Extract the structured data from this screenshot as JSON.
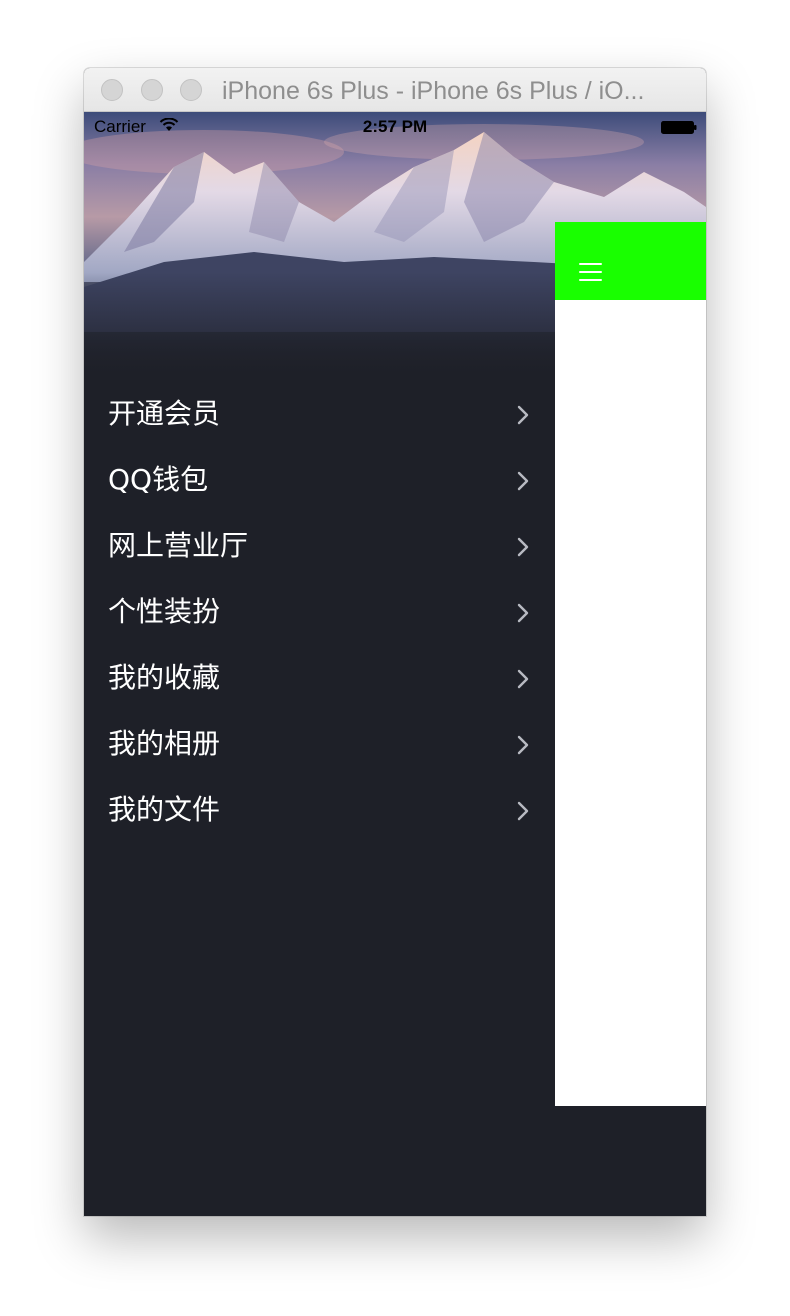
{
  "window": {
    "title": "iPhone 6s Plus - iPhone 6s Plus / iO..."
  },
  "status_bar": {
    "carrier": "Carrier",
    "time": "2:57 PM",
    "wifi_icon": "wifi-icon",
    "battery_icon": "battery-full-icon"
  },
  "menu": {
    "items": [
      {
        "label": "开通会员",
        "icon": "chevron-right-icon"
      },
      {
        "label": "QQ钱包",
        "icon": "chevron-right-icon"
      },
      {
        "label": "网上营业厅",
        "icon": "chevron-right-icon"
      },
      {
        "label": "个性装扮",
        "icon": "chevron-right-icon"
      },
      {
        "label": "我的收藏",
        "icon": "chevron-right-icon"
      },
      {
        "label": "我的相册",
        "icon": "chevron-right-icon"
      },
      {
        "label": "我的文件",
        "icon": "chevron-right-icon"
      }
    ]
  },
  "content": {
    "nav_color": "#19ff00",
    "menu_button_icon": "hamburger-menu-icon"
  },
  "colors": {
    "menu_background": "#1e2028",
    "menu_text": "#ffffff",
    "chevron": "#b8bac2"
  }
}
